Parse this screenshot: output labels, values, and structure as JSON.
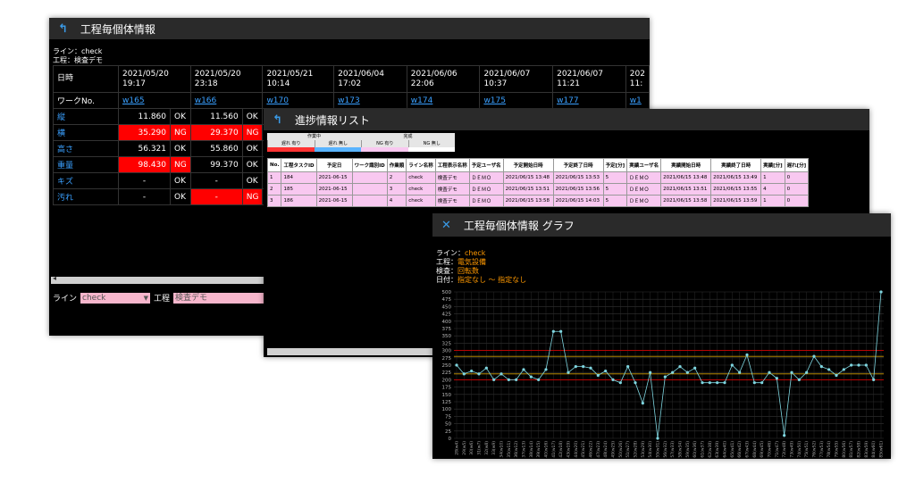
{
  "w1": {
    "title": "工程毎個体情報",
    "line_text": "ライン：check",
    "process_text": "工程：検査デモ",
    "date_label": "日時",
    "work_label": "ワークNo.",
    "columns": [
      {
        "d": "2021/05/20",
        "t": "19:17",
        "w": "w165"
      },
      {
        "d": "2021/05/20",
        "t": "23:18",
        "w": "w166"
      },
      {
        "d": "2021/05/21",
        "t": "10:14",
        "w": "w170"
      },
      {
        "d": "2021/06/04",
        "t": "17:02",
        "w": "w173"
      },
      {
        "d": "2021/06/06",
        "t": "22:06",
        "w": "w174"
      },
      {
        "d": "2021/06/07",
        "t": "10:37",
        "w": "w175"
      },
      {
        "d": "2021/06/07",
        "t": "11:21",
        "w": "w177"
      },
      {
        "d": "202",
        "t": "11:",
        "w": "w1"
      }
    ],
    "rows": [
      {
        "label": "縦",
        "cells": [
          [
            "11.860",
            "OK",
            false
          ],
          [
            "11.560",
            "OK",
            false
          ]
        ]
      },
      {
        "label": "横",
        "cells": [
          [
            "35.290",
            "NG",
            true
          ],
          [
            "29.370",
            "NG",
            true
          ]
        ]
      },
      {
        "label": "高さ",
        "cells": [
          [
            "56.321",
            "OK",
            false
          ],
          [
            "55.860",
            "OK",
            false
          ]
        ]
      },
      {
        "label": "重量",
        "cells": [
          [
            "98.430",
            "NG",
            true
          ],
          [
            "99.370",
            "OK",
            false
          ]
        ]
      },
      {
        "label": "キズ",
        "cells": [
          [
            "-",
            "OK",
            false
          ],
          [
            "-",
            "OK",
            false
          ]
        ]
      },
      {
        "label": "汚れ",
        "cells": [
          [
            "-",
            "OK",
            false
          ],
          [
            "-",
            "NG",
            true
          ]
        ]
      }
    ],
    "filter_line_label": "ライン",
    "filter_line_value": "check",
    "filter_process_label": "工程",
    "filter_process_value": "検査デモ"
  },
  "w2": {
    "title": "進捗情報リスト",
    "legend": {
      "groups": [
        "作業中",
        "完成"
      ],
      "items": [
        "遅れ 有り",
        "遅れ 無し",
        "NG 有り",
        "NG 無し"
      ],
      "colors": [
        "#ff3333",
        "#5ab4ff",
        "#f8c8f0",
        "#ffffff"
      ]
    },
    "headers": [
      "No.",
      "工程タスクID",
      "予定日",
      "ワーク識別ID",
      "作業順",
      "ライン名称",
      "工程表示名称",
      "予定ユーザ名",
      "予定開始日時",
      "予定終了日時",
      "予定[分]",
      "実績ユーザ名",
      "実績開始日時",
      "実績終了日時",
      "実績[分]",
      "遅れ[分]"
    ],
    "rows": [
      [
        "1",
        "184",
        "2021-06-15",
        "",
        "2",
        "check",
        "検査デモ",
        "ＤＥＭＯ",
        "2021/06/15 13:48",
        "2021/06/15 13:53",
        "5",
        "ＤＥＭＯ",
        "2021/06/15 13:48",
        "2021/06/15 13:49",
        "1",
        "0"
      ],
      [
        "2",
        "185",
        "2021-06-15",
        "",
        "3",
        "check",
        "検査デモ",
        "ＤＥＭＯ",
        "2021/06/15 13:51",
        "2021/06/15 13:56",
        "5",
        "ＤＥＭＯ",
        "2021/06/15 13:51",
        "2021/06/15 13:55",
        "4",
        "0"
      ],
      [
        "3",
        "186",
        "2021-06-15",
        "",
        "4",
        "check",
        "検査デモ",
        "ＤＥＭＯ",
        "2021/06/15 13:58",
        "2021/06/15 14:03",
        "5",
        "ＤＥＭＯ",
        "2021/06/15 13:58",
        "2021/06/15 13:59",
        "1",
        "0"
      ]
    ]
  },
  "w3": {
    "title": "工程毎個体情報 グラフ",
    "line_label": "ライン：",
    "line_value": "check",
    "process_label": "工程：",
    "process_value": "電気設備",
    "inspect_label": "検査：",
    "inspect_value": "回転数",
    "date_label": "日付：",
    "date_value": "指定なし 〜 指定なし"
  },
  "chart_data": {
    "type": "line",
    "ylim": [
      0,
      500
    ],
    "yticks": [
      0,
      25,
      50,
      75,
      100,
      125,
      150,
      175,
      200,
      225,
      250,
      275,
      300,
      325,
      350,
      375,
      400,
      425,
      450,
      475,
      500
    ],
    "limit_lines": [
      200,
      220,
      280,
      300
    ],
    "limit_colors": [
      "#cc0000",
      "#cc9900",
      "#cc9900",
      "#cc0000"
    ],
    "series_color": "#7fd6e0",
    "x": [
      "28(w4)",
      "29(w5)",
      "30(w6)",
      "31(w7)",
      "32(w8)",
      "33(w9)",
      "34(w10)",
      "35(w11)",
      "36(w12)",
      "37(w13)",
      "38(w14)",
      "39(w15)",
      "40(w16)",
      "41(w17)",
      "42(w18)",
      "43(w19)",
      "44(w20)",
      "45(w21)",
      "46(w22)",
      "47(w23)",
      "48(w24)",
      "49(w25)",
      "50(w26)",
      "51(w27)",
      "52(w28)",
      "53(w29)",
      "54(w30)",
      "55(w31)",
      "56(w32)",
      "57(w33)",
      "58(w34)",
      "59(w35)",
      "60(w36)",
      "61(w37)",
      "62(w38)",
      "63(w39)",
      "64(w40)",
      "65(w41)",
      "66(w42)",
      "67(w43)",
      "68(w44)",
      "69(w45)",
      "70(w46)",
      "71(w47)",
      "72(w48)",
      "73(w49)",
      "74(w50)",
      "75(w51)",
      "76(w52)",
      "77(w53)",
      "78(w54)",
      "79(w55)",
      "80(w56)",
      "81(w57)",
      "82(w58)",
      "83(w59)",
      "84(w60)",
      "85(w61)",
      "86(w62)",
      "87(w63)",
      "88(w64)",
      "89(w65)"
    ],
    "values": [
      250,
      220,
      230,
      220,
      240,
      200,
      220,
      200,
      200,
      235,
      210,
      200,
      235,
      365,
      365,
      225,
      245,
      245,
      240,
      215,
      230,
      200,
      190,
      245,
      190,
      120,
      225,
      0,
      210,
      225,
      245,
      225,
      240,
      190,
      190,
      190,
      190,
      250,
      225,
      285,
      190,
      190,
      225,
      205,
      10,
      225,
      200,
      225,
      280,
      245,
      235,
      215,
      235,
      250,
      250,
      250,
      200,
      500
    ]
  }
}
